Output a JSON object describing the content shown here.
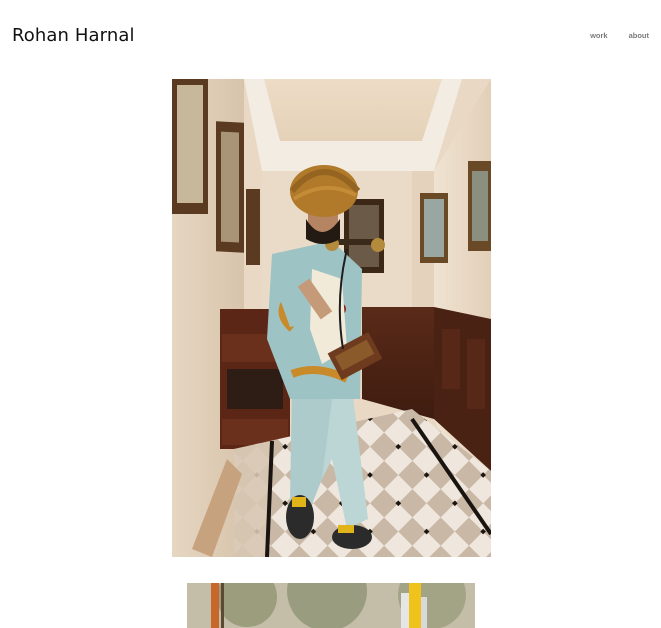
{
  "header": {
    "site_title": "Rohan Harnal",
    "nav": [
      {
        "label": "work"
      },
      {
        "label": "about"
      }
    ]
  },
  "gallery": {
    "images": [
      {
        "alt": "Man in turban and printed suit holding a vintage telephone in a hallway"
      },
      {
        "alt": "Outdoor scene with trees"
      }
    ]
  }
}
